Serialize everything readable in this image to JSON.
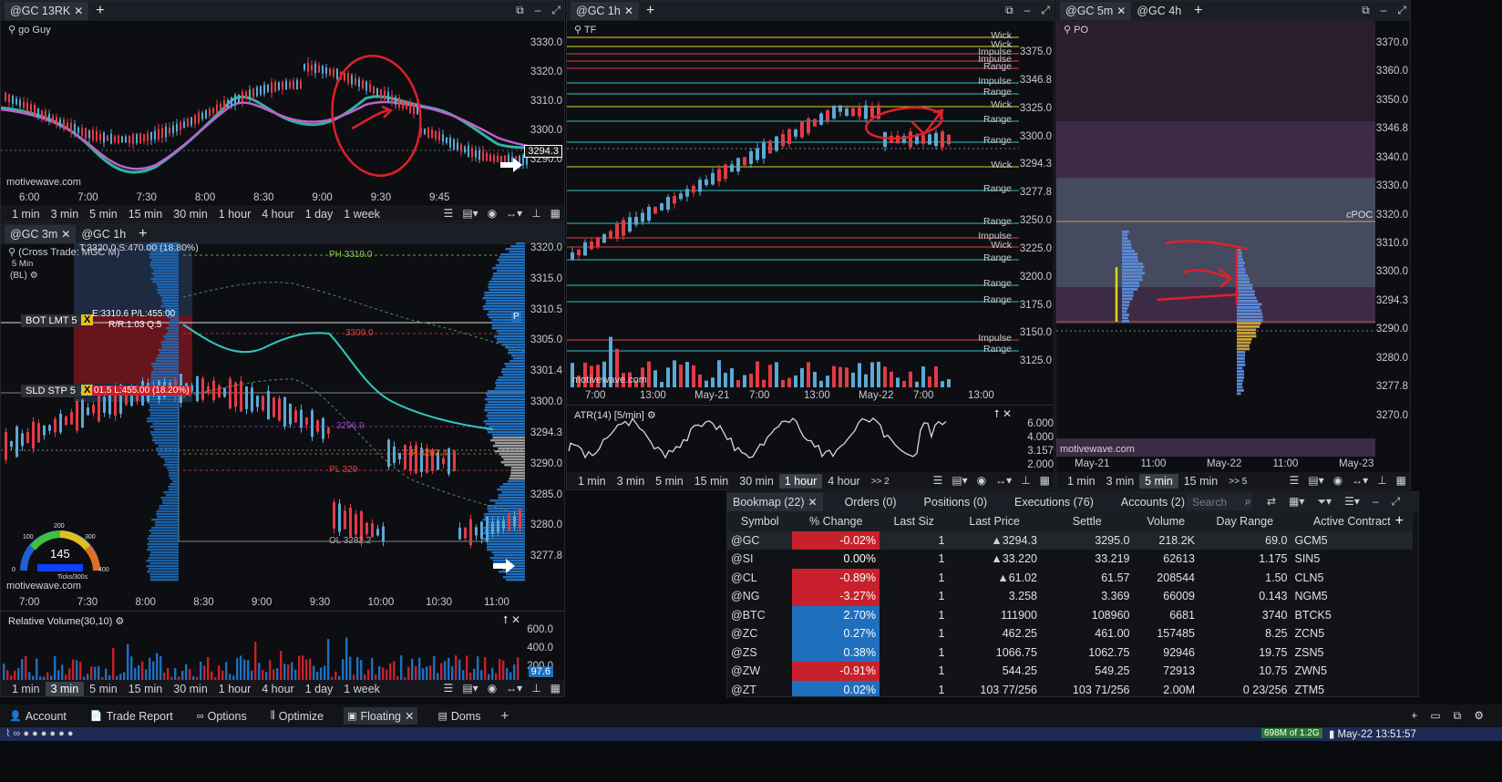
{
  "panels": {
    "top_left": {
      "tabs": [
        "@GC 13RK"
      ],
      "watermark": "motivewave.com",
      "label": "go Guy",
      "price_axis": [
        "3330.0",
        "3320.0",
        "3310.0",
        "3300.0",
        "3290.0"
      ],
      "price_badge": "3294.3",
      "time_axis": [
        "6:00",
        "7:00",
        "7:30",
        "8:00",
        "8:30",
        "9:00",
        "9:30",
        "9:45"
      ],
      "timeframes": [
        "1 min",
        "3 min",
        "5 min",
        "15 min",
        "30 min",
        "1 hour",
        "4 hour",
        "1 day",
        "1 week"
      ]
    },
    "mid_left": {
      "tabs": [
        "@GC 3m",
        "@GC 1h"
      ],
      "title": "(Cross Trade: MGC M)",
      "subtitle": "5 Min",
      "sub2": "(BL)",
      "trade_header": "T:3320.0  S:470.00 (18.80%)",
      "bot_label": "BOT LMT 5",
      "bot_info": "E:3310.6 P/L:455.00",
      "bot_rr": "R/R:1.03 Q:5",
      "sld_label": "SLD STP 5",
      "sld_info": "01.5 L:455.00 (18.20%)",
      "ph_label": "PH 3319.0",
      "pl_label": "PL 329",
      "ol_label": "OL 3282.2",
      "red_label": "3309.0",
      "purple_label": "3296.9",
      "orange_label": "P 3293.4",
      "price_axis": [
        "3320.0",
        "3315.0",
        "3310.5",
        "3305.0",
        "3301.4",
        "3300.0",
        "3294.3",
        "3290.0",
        "3285.0",
        "3280.0",
        "3277.8"
      ],
      "time_axis": [
        "7:00",
        "7:30",
        "8:00",
        "8:30",
        "9:00",
        "9:30",
        "10:00",
        "10:30",
        "11:00"
      ],
      "gauge_value": "145",
      "gauge_top": "200",
      "gauge_l": "100",
      "gauge_r": "300",
      "gauge_unit": "Ticks/300s",
      "gauge_zero": "0",
      "gauge_max": "400",
      "watermark": "motivewave.com",
      "rv_title": "Relative Volume(30,10)",
      "rv_axis": [
        "600.0",
        "400.0",
        "200.0"
      ],
      "rv_badge": "97.6",
      "timeframes": [
        "1 min",
        "3 min",
        "5 min",
        "15 min",
        "30 min",
        "1 hour",
        "4 hour",
        "1 day",
        "1 week"
      ],
      "selected_tf": "3 min",
      "profile_badge": "P"
    },
    "top_mid": {
      "tabs": [
        "@GC 1h"
      ],
      "label": "TF",
      "levels": [
        "Wick",
        "Wick",
        "Impulse",
        "Impulse",
        "Range",
        "Impulse",
        "Range",
        "Wick",
        "Range",
        "Range",
        "Wick",
        "Range",
        "Range",
        "Impulse",
        "Wick",
        "Range",
        "Range",
        "Range",
        "Impulse",
        "Range"
      ],
      "price_axis": [
        "3375.0",
        "3346.8",
        "3325.0",
        "3300.0",
        "3294.3",
        "3277.8",
        "3250.0",
        "3225.0",
        "3200.0",
        "3175.0",
        "3150.0",
        "3125.0"
      ],
      "vol_badge": "6737",
      "time_axis": [
        "7:00",
        "13:00",
        "May-21",
        "7:00",
        "13:00",
        "May-22",
        "7:00",
        "13:00"
      ],
      "watermark": "motivewave.com",
      "atr_title": "ATR(14) [5/min]",
      "atr_axis": [
        "6.000",
        "4.000",
        "3.157",
        "2.000"
      ],
      "timeframes": [
        "1 min",
        "3 min",
        "5 min",
        "15 min",
        "30 min",
        "1 hour",
        "4 hour"
      ],
      "selected_tf": "1 hour",
      "more": ">> 2"
    },
    "top_right": {
      "tabs": [
        "@GC 5m",
        "@GC 4h"
      ],
      "label": "PO",
      "cpoc": "cPOC",
      "price_axis": [
        "3370.0",
        "3360.0",
        "3350.0",
        "3346.8",
        "3340.0",
        "3330.0",
        "3320.0",
        "3310.0",
        "3300.0",
        "3294.3",
        "3290.0",
        "3280.0",
        "3277.8",
        "3270.0"
      ],
      "time_axis": [
        "May-21",
        "11:00",
        "May-22",
        "11:00",
        "May-23"
      ],
      "watermark": "motivewave.com",
      "timeframes": [
        "1 min",
        "3 min",
        "5 min",
        "15 min"
      ],
      "selected_tf": "5 min",
      "more": ">> 5"
    }
  },
  "bookmap": {
    "tabs": [
      "Bookmap (22)",
      "Orders (0)",
      "Positions (0)",
      "Executions (76)",
      "Accounts (2)"
    ],
    "search_placeholder": "Search",
    "columns": [
      "Symbol",
      "% Change",
      "Last Siz",
      "Last Price",
      "Settle",
      "Volume",
      "Day Range",
      "Active Contract"
    ],
    "rows": [
      {
        "symbol": "@GC",
        "change": "-0.02%",
        "size": "1",
        "last": "3294.3",
        "settle": "3295.0",
        "volume": "218.2K",
        "range": "69.0",
        "contract": "GCM5",
        "dir": "up",
        "color": "#c8202c"
      },
      {
        "symbol": "@SI",
        "change": "0.00%",
        "size": "1",
        "last": "33.220",
        "settle": "33.219",
        "volume": "62613",
        "range": "1.175",
        "contract": "SIN5",
        "dir": "up",
        "color": ""
      },
      {
        "symbol": "@CL",
        "change": "-0.89%",
        "size": "1",
        "last": "61.02",
        "settle": "61.57",
        "volume": "208544",
        "range": "1.50",
        "contract": "CLN5",
        "dir": "up",
        "color": "#c8202c"
      },
      {
        "symbol": "@NG",
        "change": "-3.27%",
        "size": "1",
        "last": "3.258",
        "settle": "3.369",
        "volume": "66009",
        "range": "0.143",
        "contract": "NGM5",
        "dir": "",
        "color": "#c8202c"
      },
      {
        "symbol": "@BTC",
        "change": "2.70%",
        "size": "1",
        "last": "111900",
        "settle": "108960",
        "volume": "6681",
        "range": "3740",
        "contract": "BTCK5",
        "dir": "",
        "color": "#1f6fbf"
      },
      {
        "symbol": "@ZC",
        "change": "0.27%",
        "size": "1",
        "last": "462.25",
        "settle": "461.00",
        "volume": "157485",
        "range": "8.25",
        "contract": "ZCN5",
        "dir": "",
        "color": "#1f6fbf"
      },
      {
        "symbol": "@ZS",
        "change": "0.38%",
        "size": "1",
        "last": "1066.75",
        "settle": "1062.75",
        "volume": "92946",
        "range": "19.75",
        "contract": "ZSN5",
        "dir": "",
        "color": "#1f6fbf"
      },
      {
        "symbol": "@ZW",
        "change": "-0.91%",
        "size": "1",
        "last": "544.25",
        "settle": "549.25",
        "volume": "72913",
        "range": "10.75",
        "contract": "ZWN5",
        "dir": "",
        "color": "#c8202c"
      },
      {
        "symbol": "@ZT",
        "change": "0.02%",
        "size": "1",
        "last": "103 77/256",
        "settle": "103 71/256",
        "volume": "2.00M",
        "range": "0 23/256",
        "contract": "ZTM5",
        "dir": "",
        "color": "#1f6fbf"
      }
    ]
  },
  "bottom_bar": {
    "items": [
      "Account",
      "Trade Report",
      "Options",
      "Optimize",
      "Floating",
      "Doms"
    ],
    "active": "Floating"
  },
  "status": {
    "memory": "698M of 1.2G",
    "datetime": "May-22 13:51:57"
  },
  "colors": {
    "up": "#5aa9d6",
    "down": "#e23b46",
    "panel_bg": "#0d0e12",
    "annotation": "#e0202a"
  }
}
